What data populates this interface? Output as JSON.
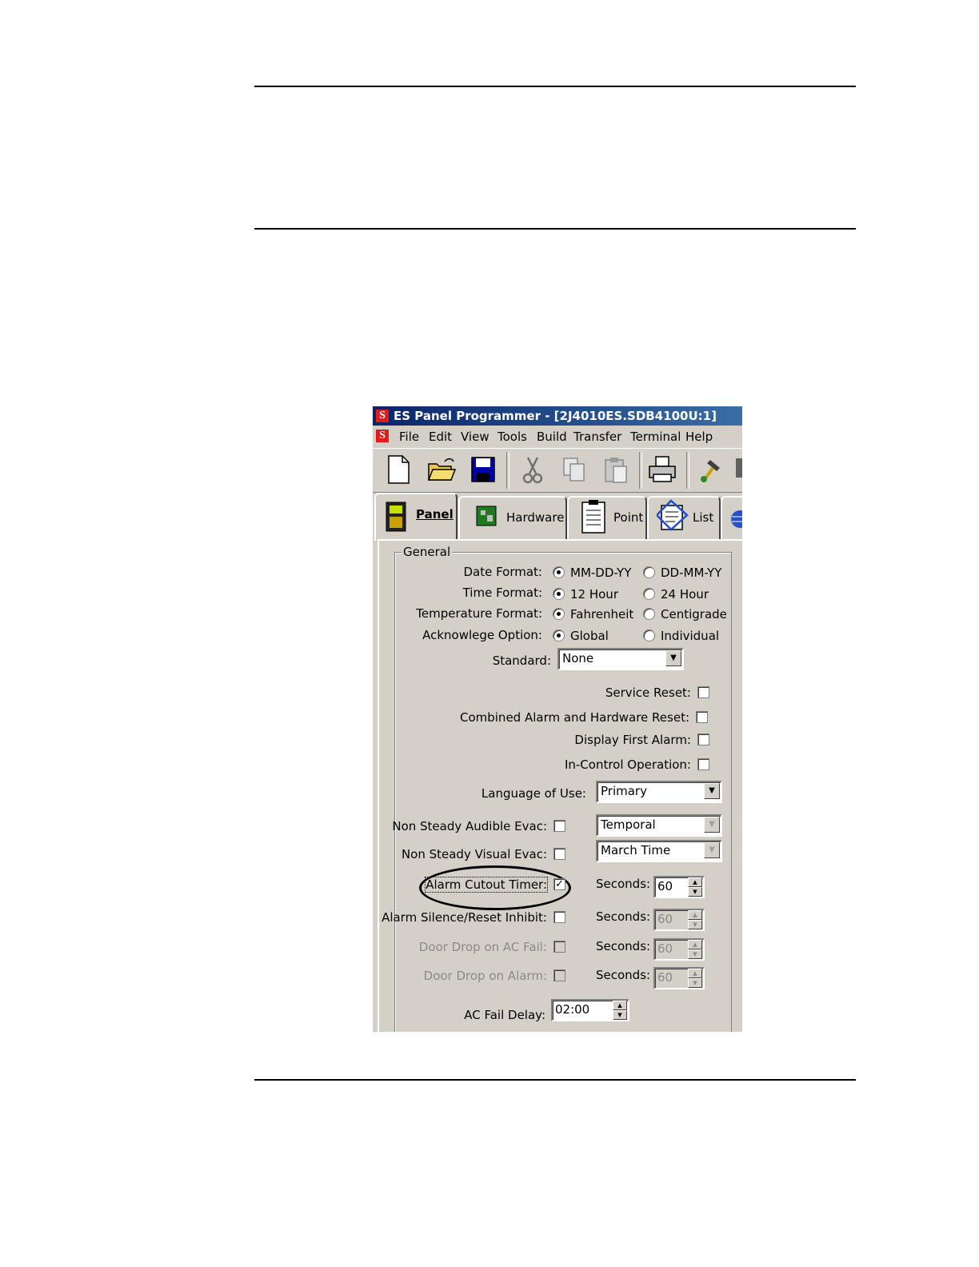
{
  "window": {
    "title": "ES Panel Programmer - [2J4010ES.SDB4100U:1]"
  },
  "menu": [
    "File",
    "Edit",
    "View",
    "Tools",
    "Build",
    "Transfer",
    "Terminal",
    "Help"
  ],
  "toolbar": [
    "new-file-icon",
    "open-folder-icon",
    "save-icon",
    "cut-icon",
    "copy-icon",
    "paste-icon",
    "print-icon",
    "build-hammer-icon"
  ],
  "tabs": {
    "panel": "Panel",
    "hardware": "Hardware",
    "point": "Point",
    "list": "List"
  },
  "general": {
    "group_label": "General",
    "date_format": {
      "label": "Date Format:",
      "opt1": "MM-DD-YY",
      "opt2": "DD-MM-YY",
      "selected": "MM-DD-YY"
    },
    "time_format": {
      "label": "Time Format:",
      "opt1": "12 Hour",
      "opt2": "24 Hour",
      "selected": "12 Hour"
    },
    "temperature_format": {
      "label": "Temperature Format:",
      "opt1": "Fahrenheit",
      "opt2": "Centigrade",
      "selected": "Fahrenheit"
    },
    "acknowledge_option": {
      "label": "Acknowlege Option:",
      "opt1": "Global",
      "opt2": "Individual",
      "selected": "Global"
    },
    "standard": {
      "label": "Standard:",
      "value": "None"
    },
    "service_reset": {
      "label": "Service Reset:",
      "checked": false
    },
    "combined_reset": {
      "label": "Combined Alarm and Hardware Reset:",
      "checked": false
    },
    "display_first_alarm": {
      "label": "Display First Alarm:",
      "checked": false
    },
    "in_control_operation": {
      "label": "In-Control Operation:",
      "checked": false
    },
    "language": {
      "label": "Language of Use:",
      "value": "Primary"
    },
    "non_steady_audible": {
      "label": "Non Steady Audible Evac:",
      "checked": false,
      "value": "Temporal"
    },
    "non_steady_visual": {
      "label": "Non Steady Visual Evac:",
      "checked": false,
      "value": "March Time"
    },
    "alarm_cutout_timer": {
      "label": "Alarm Cutout Timer:",
      "checked": true,
      "seconds_label": "Seconds:",
      "seconds": "60"
    },
    "alarm_silence_reset_inhibit": {
      "label": "Alarm Silence/Reset Inhibit:",
      "checked": false,
      "seconds_label": "Seconds:",
      "seconds": "60"
    },
    "door_drop_ac_fail": {
      "label": "Door Drop on AC Fail:",
      "checked": false,
      "seconds_label": "Seconds:",
      "seconds": "60"
    },
    "door_drop_alarm": {
      "label": "Door Drop on Alarm:",
      "checked": false,
      "seconds_label": "Seconds:",
      "seconds": "60"
    },
    "ac_fail_delay": {
      "label": "AC Fail Delay:",
      "value": "02:00"
    }
  },
  "colors": {
    "titlebar": "#0a246a",
    "window_bg": "#d4d0c8",
    "logo_red": "#e21b1b"
  }
}
